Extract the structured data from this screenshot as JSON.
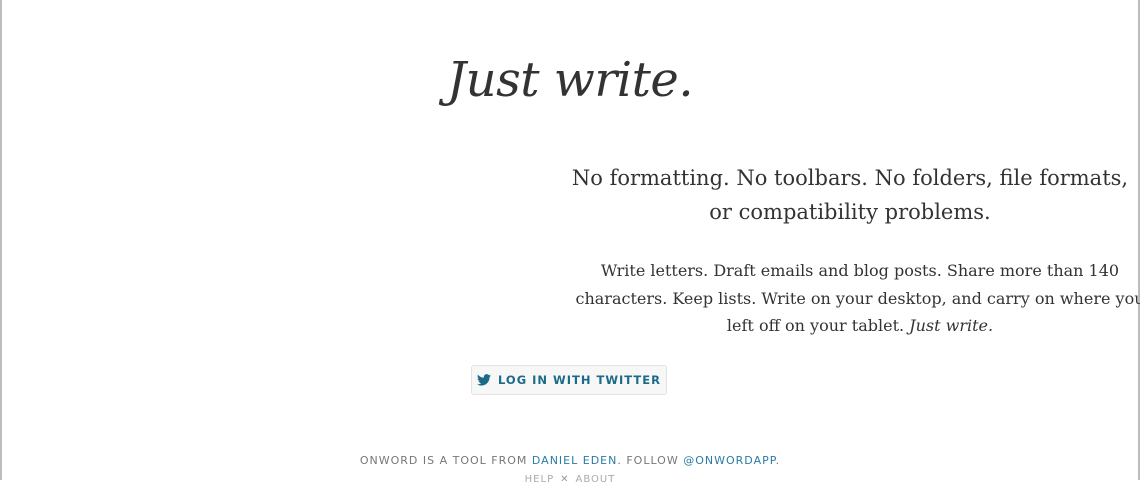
{
  "hero": {
    "title": "Just write."
  },
  "lead": {
    "text": "No formatting. No toolbars. No folders, file formats, or compatibility problems."
  },
  "body": {
    "text": "Write letters. Draft emails and blog posts. Share more than 140 characters. Keep lists. Write on your desktop, and carry on where you left off on your tablet.",
    "emphasis": "Just write."
  },
  "login_button": {
    "label": "LOG IN WITH TWITTER",
    "icon": "twitter-bird-icon",
    "color": "#1c6a8a"
  },
  "footer": {
    "prefix": "ONWORD IS A TOOL FROM",
    "author_link": "DANIEL EDEN",
    "follow_text": ". FOLLOW",
    "handle_link": "@ONWORDAPP",
    "suffix": ".",
    "links": [
      {
        "label": "HELP"
      },
      {
        "label": "ABOUT"
      }
    ],
    "separator": "✕"
  },
  "colors": {
    "accent": "#2a7ba5",
    "text": "#333333",
    "muted": "#777777"
  }
}
